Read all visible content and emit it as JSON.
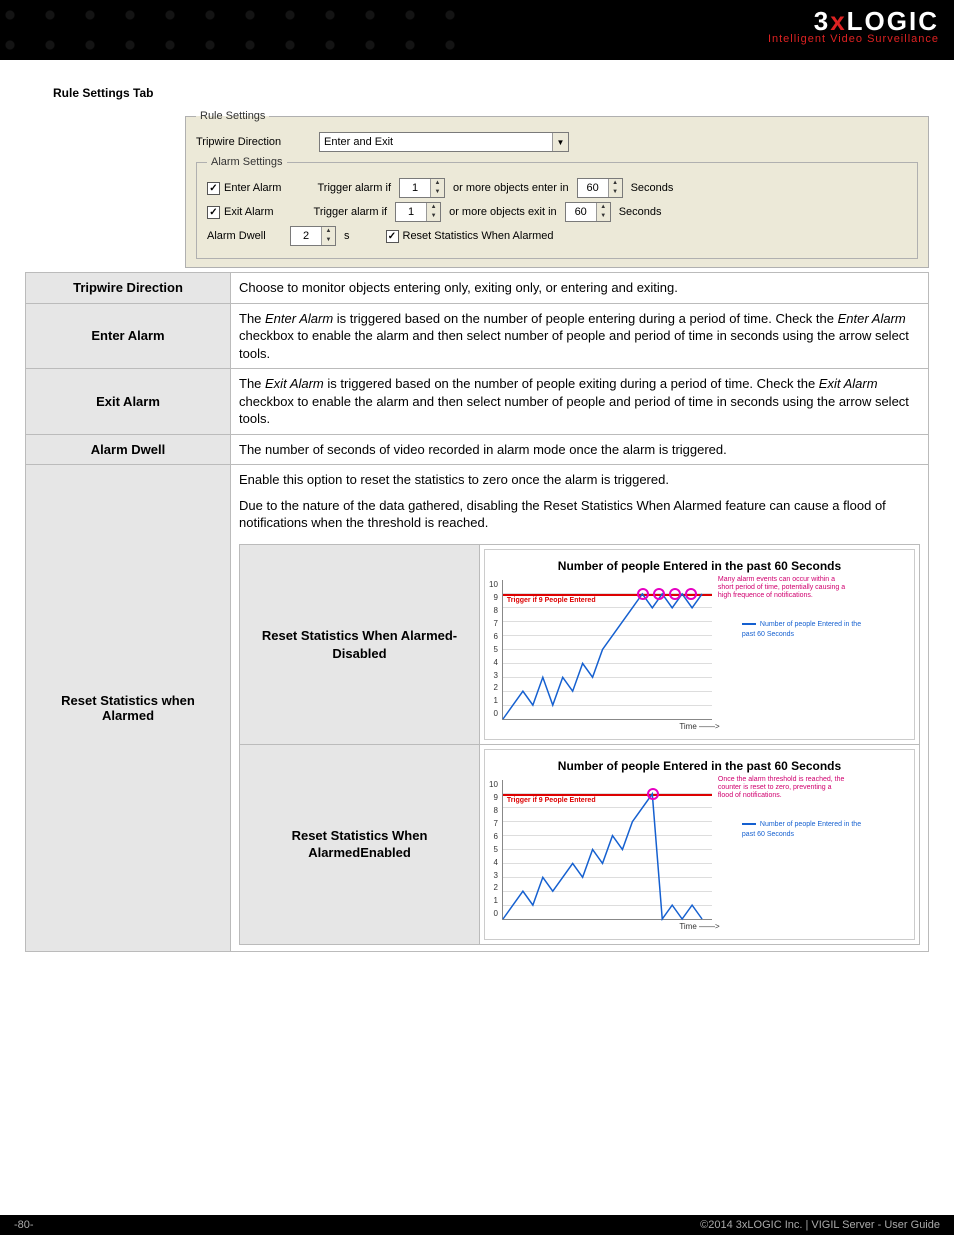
{
  "header": {
    "logo_top": "3xLOGIC",
    "logo_sub": "Intelligent Video Surveillance"
  },
  "section_title": "Rule Settings Tab",
  "dialog": {
    "fs_rule": "Rule Settings",
    "tripwire_label": "Tripwire Direction",
    "tripwire_value": "Enter and Exit",
    "fs_alarm": "Alarm Settings",
    "enter_alarm_label": "Enter Alarm",
    "exit_alarm_label": "Exit Alarm",
    "trigger_prefix": "Trigger alarm if",
    "trigger_enter_mid": "or more objects enter in",
    "trigger_exit_mid": "or more objects exit in",
    "seconds": "Seconds",
    "count_val": "1",
    "time_val": "60",
    "dwell_label": "Alarm Dwell",
    "dwell_val": "2",
    "dwell_unit": "s",
    "reset_label": "Reset Statistics When Alarmed"
  },
  "table": {
    "rows": [
      {
        "h": "Tripwire Direction",
        "b": "Choose to monitor objects entering only, exiting only, or entering and exiting."
      },
      {
        "h": "Enter Alarm",
        "b": "The Enter Alarm is triggered based on the number of people entering during a period of time. Check the Enter Alarm checkbox to enable the alarm and then select number of people and period of time in seconds using the arrow select tools."
      },
      {
        "h": "Exit Alarm",
        "b": "The Exit Alarm is triggered based on the number of people exiting during a period of time. Check the Exit Alarm checkbox to enable the alarm and then select number of people and period of time in seconds using the arrow select tools."
      },
      {
        "h": "Alarm Dwell",
        "b": "The number of seconds of video recorded in alarm mode once the alarm is triggered."
      }
    ],
    "reset_h": "Reset Statistics when Alarmed",
    "reset_p1": "Enable this option to reset the statistics to zero once the alarm is triggered.",
    "reset_p2": "Due to the nature of the data gathered, disabling the Reset Statistics When Alarmed feature can cause a flood of notifications when the threshold is reached.",
    "inner": {
      "disabled_label": "Reset Statistics When Alarmed- Disabled",
      "enabled_label": "Reset Statistics When AlarmedEnabled"
    }
  },
  "chart_data": [
    {
      "type": "line",
      "title": "Number of people Entered in the past 60 Seconds",
      "ylabel": "",
      "xlabel": "Time ——>",
      "ylim": [
        0,
        10
      ],
      "threshold": {
        "value": 9,
        "label": "Trigger if 9 People Entered"
      },
      "series": [
        {
          "name": "Number of people Entered in the past 60 Seconds",
          "values": [
            0,
            1,
            2,
            1,
            3,
            1,
            3,
            2,
            4,
            3,
            5,
            6,
            7,
            8,
            9,
            8,
            9,
            8,
            9,
            8,
            9
          ]
        }
      ],
      "annotation": "Many alarm events can occur within a short period of time, potentially causing a high frequence of notifications."
    },
    {
      "type": "line",
      "title": "Number of people Entered in the past 60 Seconds",
      "ylabel": "",
      "xlabel": "Time ——>",
      "ylim": [
        0,
        10
      ],
      "threshold": {
        "value": 9,
        "label": "Trigger if 9 People Entered"
      },
      "series": [
        {
          "name": "Number of people Entered in the past 60 Seconds",
          "values": [
            0,
            1,
            2,
            1,
            3,
            2,
            3,
            4,
            3,
            5,
            4,
            6,
            5,
            7,
            8,
            9,
            0,
            1,
            0,
            1,
            0
          ]
        }
      ],
      "annotation": "Once the alarm threshold is reached, the counter is reset to zero, preventing a flood of notifications."
    }
  ],
  "footer": {
    "left": "-80-",
    "right": "©2014 3xLOGIC Inc. | VIGIL Server - User Guide"
  }
}
